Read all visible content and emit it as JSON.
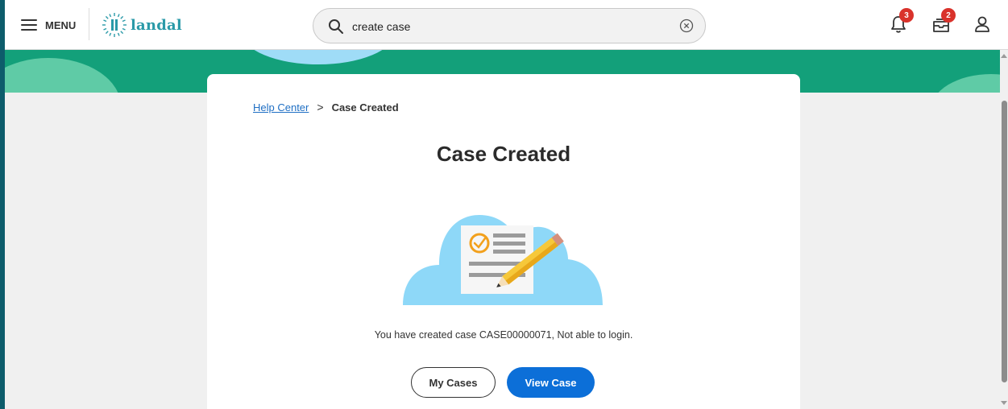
{
  "header": {
    "menu_label": "MENU",
    "logo_text": "landal",
    "search": {
      "value": "create case",
      "placeholder": ""
    },
    "notifications": {
      "count": "3",
      "icon": "bell-icon"
    },
    "inbox": {
      "count": "2",
      "icon": "inbox-icon"
    },
    "profile": {
      "icon": "user-icon"
    }
  },
  "breadcrumb": {
    "link": "Help Center",
    "separator": ">",
    "current": "Case Created"
  },
  "main": {
    "title": "Case Created",
    "message": "You have created case CASE00000071, Not able to login.",
    "buttons": {
      "my_cases": "My Cases",
      "view_case": "View Case"
    }
  },
  "colors": {
    "banner": "#13a07a",
    "primary": "#0c6fd8",
    "badge": "#d9322b",
    "link": "#1f6fc4",
    "logo": "#2a9aa8"
  }
}
